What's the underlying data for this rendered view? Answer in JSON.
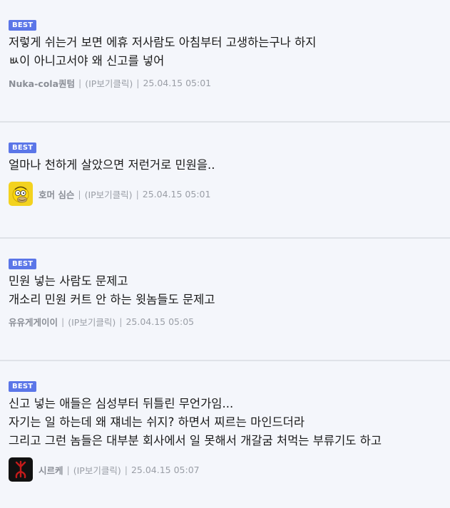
{
  "comments": [
    {
      "badge": "BEST",
      "lines": [
        "저렇게 쉬는거 보면 에휴 저사람도 아침부터 고생하는구나 하지",
        "ㅄ이 아니고서야 왜 신고를 넣어"
      ],
      "nickname": "Nuka-cola퀀텀",
      "ip": "(IP보기클릭)",
      "datetime": "25.04.15 05:01",
      "sep": "|"
    },
    {
      "badge": "BEST",
      "lines": [
        "얼마나 천하게 살았으면 저런거로 민원을.."
      ],
      "avatar": "homer-simpson-avatar-icon",
      "nickname": "호머 심슨",
      "ip": "(IP보기클릭)",
      "datetime": "25.04.15 05:01",
      "sep": "|"
    },
    {
      "badge": "BEST",
      "lines": [
        "민원 넣는 사람도 문제고",
        "개소리 민원 커트 안 하는 윗놈들도 문제고"
      ],
      "nickname": "유유게게이이",
      "ip": "(IP보기클릭)",
      "datetime": "25.04.15 05:05",
      "sep": "|"
    },
    {
      "badge": "BEST",
      "lines": [
        "신고 넣는 애들은 심성부터 뒤틀린 무언가임...",
        "자기는 일 하는데 왜 쟤네는 쉬지? 하면서 찌르는 마인드더라",
        "그리고 그런 놈들은 대부분 회사에서 일 못해서 개갈굼 처먹는 부류기도 하고"
      ],
      "avatar": "brand-of-sacrifice-avatar-icon",
      "nickname": "시르케",
      "ip": "(IP보기클릭)",
      "datetime": "25.04.15 05:07",
      "sep": "|"
    }
  ],
  "colors": {
    "background": "#f4f6fb",
    "badge": "#5b76e8",
    "meta_text": "#9a9ea6",
    "divider": "#dfe2e8"
  }
}
